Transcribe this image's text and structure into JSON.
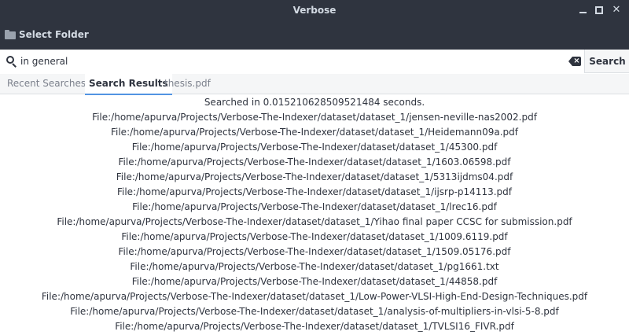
{
  "window": {
    "title": "Verbose"
  },
  "toolbar": {
    "select_folder_label": "Select Folder"
  },
  "search": {
    "query": "in general",
    "button_label": "Search"
  },
  "tabs": [
    {
      "label": "Recent Searches"
    },
    {
      "label": "Search Results"
    },
    {
      "label": "thesis.pdf"
    }
  ],
  "results": {
    "summary": "Searched in 0.015210628509521484 seconds.",
    "files": [
      "File:/home/apurva/Projects/Verbose-The-Indexer/dataset/dataset_1/jensen-neville-nas2002.pdf",
      "File:/home/apurva/Projects/Verbose-The-Indexer/dataset/dataset_1/Heidemann09a.pdf",
      "File:/home/apurva/Projects/Verbose-The-Indexer/dataset/dataset_1/45300.pdf",
      "File:/home/apurva/Projects/Verbose-The-Indexer/dataset/dataset_1/1603.06598.pdf",
      "File:/home/apurva/Projects/Verbose-The-Indexer/dataset/dataset_1/5313ijdms04.pdf",
      "File:/home/apurva/Projects/Verbose-The-Indexer/dataset/dataset_1/ijsrp-p14113.pdf",
      "File:/home/apurva/Projects/Verbose-The-Indexer/dataset/dataset_1/lrec16.pdf",
      "File:/home/apurva/Projects/Verbose-The-Indexer/dataset/dataset_1/Yihao final paper CCSC for submission.pdf",
      "File:/home/apurva/Projects/Verbose-The-Indexer/dataset/dataset_1/1009.6119.pdf",
      "File:/home/apurva/Projects/Verbose-The-Indexer/dataset/dataset_1/1509.05176.pdf",
      "File:/home/apurva/Projects/Verbose-The-Indexer/dataset/dataset_1/pg1661.txt",
      "File:/home/apurva/Projects/Verbose-The-Indexer/dataset/dataset_1/44858.pdf",
      "File:/home/apurva/Projects/Verbose-The-Indexer/dataset/dataset_1/Low-Power-VLSI-High-End-Design-Techniques.pdf",
      "File:/home/apurva/Projects/Verbose-The-Indexer/dataset/dataset_1/analysis-of-multipliers-in-vlsi-5-8.pdf",
      "File:/home/apurva/Projects/Verbose-The-Indexer/dataset/dataset_1/TVLSI16_FIVR.pdf"
    ]
  }
}
